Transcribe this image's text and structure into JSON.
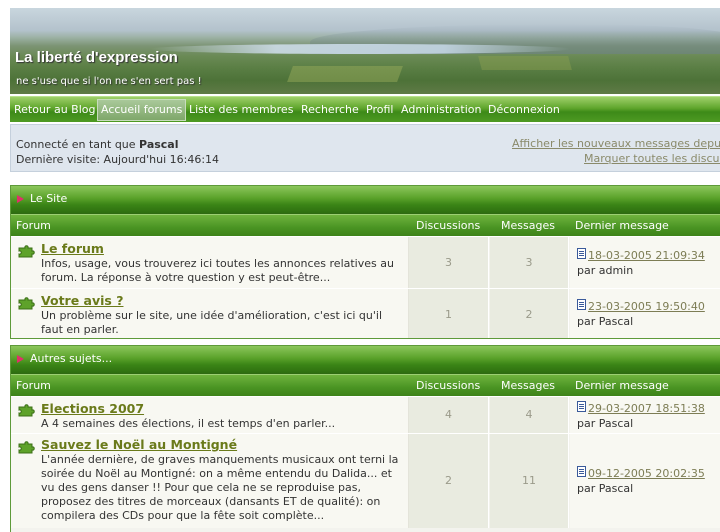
{
  "header": {
    "title": "La liberté d'expression",
    "subtitle": "ne s'use que si l'on ne s'en sert pas !"
  },
  "nav": {
    "items": [
      {
        "label": "Retour au Blog",
        "active": false
      },
      {
        "label": "Accueil forums",
        "active": true
      },
      {
        "label": "Liste des membres",
        "active": false
      },
      {
        "label": "Recherche",
        "active": false
      },
      {
        "label": "Profil",
        "active": false
      },
      {
        "label": "Administration",
        "active": false
      },
      {
        "label": "Déconnexion",
        "active": false
      }
    ]
  },
  "info": {
    "logged_prefix": "Connecté en tant que",
    "username": "Pascal",
    "last_visit": "Dernière visite: Aujourd'hui 16:46:14",
    "link_new_messages": "Afficher les nouveaux messages depuis",
    "link_mark_read": "Marquer toutes les discussions"
  },
  "columns": {
    "forum": "Forum",
    "discussions": "Discussions",
    "messages": "Messages",
    "last_message": "Dernier message"
  },
  "categories": [
    {
      "title": "Le Site",
      "forums": [
        {
          "name": "Le forum",
          "description": "Infos, usage, vous trouverez ici toutes les annonces relatives au forum. La réponse à votre question y est peut-être...",
          "discussions": "3",
          "messages": "3",
          "last_date": "18-03-2005 21:09:34",
          "last_by": "par admin"
        },
        {
          "name": "Votre avis ?",
          "description": "Un problème sur le site, une idée d'amélioration, c'est ici qu'il faut en parler.",
          "discussions": "1",
          "messages": "2",
          "last_date": "23-03-2005 19:50:40",
          "last_by": "par Pascal"
        }
      ]
    },
    {
      "title": "Autres sujets...",
      "forums": [
        {
          "name": "Elections 2007",
          "description": "A 4 semaines des élections, il est temps d'en parler...",
          "discussions": "4",
          "messages": "4",
          "last_date": "29-03-2007 18:51:38",
          "last_by": "par Pascal"
        },
        {
          "name": "Sauvez le Noël au Montigné",
          "description": "L'année dernière, de graves manquements musicaux ont terni la soirée du Noël au Montigné: on a même entendu du Dalida... et vu des gens danser !! Pour que cela ne se reproduise pas, proposez des titres de morceaux (dansants ET de qualité): on compilera des CDs pour que la fête soit complète...",
          "discussions": "2",
          "messages": "11",
          "last_date": "09-12-2005 20:02:35",
          "last_by": "par Pascal"
        }
      ]
    }
  ]
}
